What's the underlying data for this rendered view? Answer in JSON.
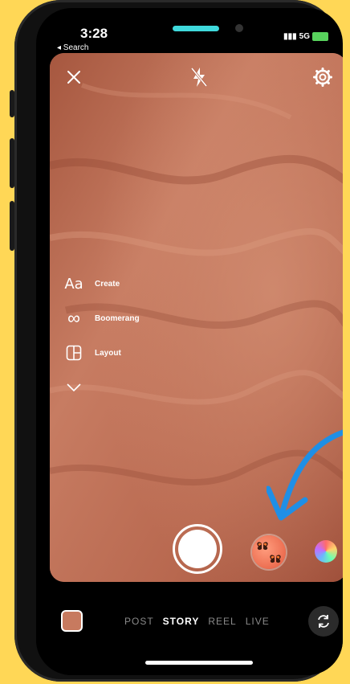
{
  "status_bar": {
    "time": "3:28",
    "back_label": "◂ Search",
    "signal_label": "5G",
    "battery_color": "#58d35d"
  },
  "camera": {
    "close_icon": "close-icon",
    "flash_icon": "flash-off-icon",
    "settings_icon": "gear-icon",
    "menu": [
      {
        "icon": "text-aa-icon",
        "glyph": "Aa",
        "label": "Create"
      },
      {
        "icon": "infinity-icon",
        "glyph": "∞",
        "label": "Boomerang"
      },
      {
        "icon": "layout-icon",
        "glyph": "",
        "label": "Layout"
      }
    ],
    "expand_icon": "chevron-down-icon"
  },
  "modes": {
    "items": [
      "POST",
      "STORY",
      "REEL",
      "LIVE"
    ],
    "active": "STORY"
  },
  "colors": {
    "background": "#ffd756",
    "viewfinder": "#b86a52",
    "arrow": "#1f8fe6"
  }
}
